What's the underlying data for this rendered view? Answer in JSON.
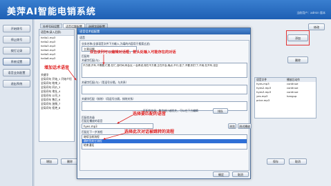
{
  "app": {
    "title": "美萍AI智能电销系统",
    "user_info": "当前用户：admin  版本"
  },
  "sidebar": {
    "items": [
      "开始拨号",
      "停止拨号",
      "拨打记录",
      "系统设置",
      "语音业务配置",
      "退出系统"
    ]
  },
  "tabs": [
    "外呼号码设置",
    "语音话题配置",
    "选择字段配置"
  ],
  "left_panel": {
    "header": "语音库(录入后即)",
    "rows": [
      "hello1.mp3",
      "hello2.mp3",
      "hello3.mp3",
      "hello4.mp3",
      "hello5.mp3",
      "hello6.mp3",
      "",
      "",
      "",
      "关键字",
      "全局问句 开始_1 开始介绍",
      "全局问句 结束_2",
      "全局问句 问价_3",
      "全局问句 地址_4",
      "全局问句 公司_5",
      "全局问句 售后_6",
      "全局问句 加微_7",
      "全局问句 拒绝_8"
    ]
  },
  "right_panel": {
    "headers": [
      "语音文件",
      "播放后动作"
    ],
    "rows": [
      [
        "hyes.mp3",
        "continue"
      ],
      [
        "hyes2.mp3",
        "continue"
      ],
      [
        "hyes3.mp3",
        "continue"
      ],
      [
        "yes.mp3",
        "hangup"
      ],
      [
        "price.mp3",
        ""
      ]
    ]
  },
  "right_buttons": {
    "top": "修改",
    "add": "添加",
    "delete": "删除"
  },
  "bottom_buttons": [
    "增加",
    "删除",
    "保存",
    "取消"
  ],
  "footer_note": "说明：语音文件请放到安装目录下Call\\话术目录中",
  "dialog": {
    "title": "语音话术组配置",
    "section_label": "语音",
    "name_label": "业务名称(全部语音文件下方输入,为填的内容用于搜索过滤)",
    "name_value": "主营问题",
    "match_label": "匹配的",
    "keywords_label": "关键字匹配(与)",
    "keywords_text": "不方便,开车,不需要,忙着,在忙,没时间,有会议,一会再说,现在不方便,正在开会,晚点,不行,挂了,不要,别打了,不用,在开车,没空",
    "kw2_label": "关键字匹配(与)（用逗号分隔，与关系）",
    "kw3_label": "关键字匹配（排除）（用逗号分隔，排除关系）",
    "hint": "匹配优先级：数字越小越优先，可以在下方编辑",
    "priority_label": "匹配优先级",
    "priority_value": "0",
    "order_button": "排队",
    "voice_label": "匹配后播放的语音",
    "voice_value": "hyes.mp3",
    "browse_button": "浏览",
    "test_button": "测试播放",
    "flow_label": "匹配后下一步流程",
    "flow_items": [
      "继续当前流程",
      "跳转到其它流程",
      "结束通话"
    ],
    "ok_button": "确定",
    "cancel_button": "取消"
  },
  "annotations": {
    "add_voice": "增加话术语音",
    "double_click": "双击该列可以编辑对话框，箭头处输入可能存在的对话",
    "select_voice": "选择要匹配的语音",
    "select_flow": "选择此次对话被跳转的流程"
  },
  "colors": {
    "annotation": "#e02020",
    "titlebar": "#2b65b0",
    "selection": "#2f6fd6"
  }
}
